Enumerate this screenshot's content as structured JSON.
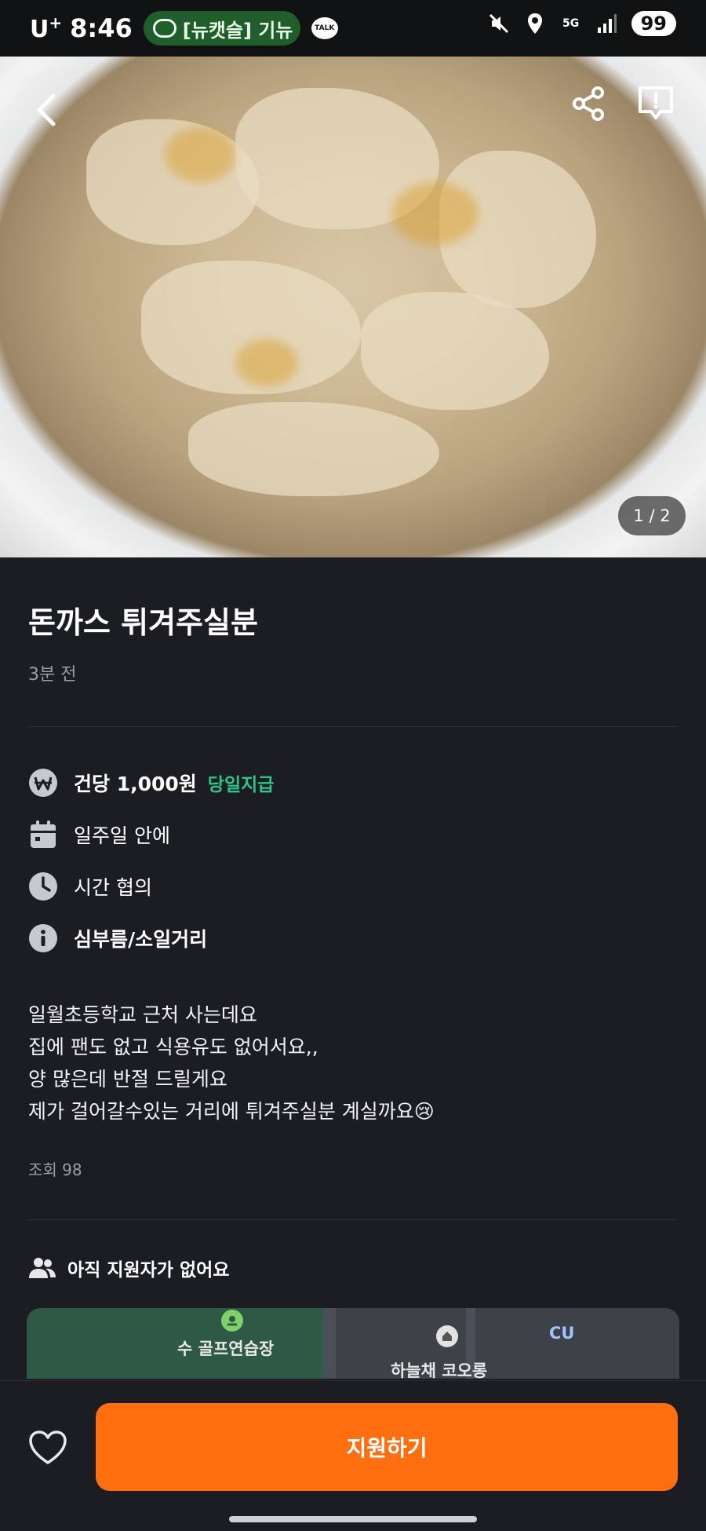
{
  "status_bar": {
    "carrier": "U",
    "carrier_sup": "+",
    "time": "8:46",
    "notification": "[뉴캣슬] 기뉴",
    "talk_label": "TALK",
    "network": "5G",
    "battery": "99"
  },
  "hero": {
    "page_indicator": "1 / 2"
  },
  "post": {
    "title": "돈까스 튀겨주실분",
    "time_ago": "3분 전",
    "pay": "건당 1,000원",
    "pay_tag": "당일지급",
    "schedule": "일주일 안에",
    "time": "시간 협의",
    "category": "심부름/소일거리",
    "description": [
      "일월초등학교 근처 사는데요",
      "집에 팬도 없고 식용유도 없어서요,,",
      "양 많은데 반절 드릴게요",
      "제가 걸어갈수있는 거리에 튀겨주실분 계실까요😢"
    ],
    "views": "조회 98",
    "applicants": "아직 지원자가 없어요"
  },
  "map": {
    "poi_golf": "수 골프연습장",
    "poi_apartment": "하늘채 코오롱",
    "poi_store": "CU"
  },
  "bottom": {
    "apply_label": "지원하기"
  },
  "colors": {
    "accent": "#ff6f0f",
    "pay_tag": "#2bc48a",
    "background": "#1c1d22"
  }
}
